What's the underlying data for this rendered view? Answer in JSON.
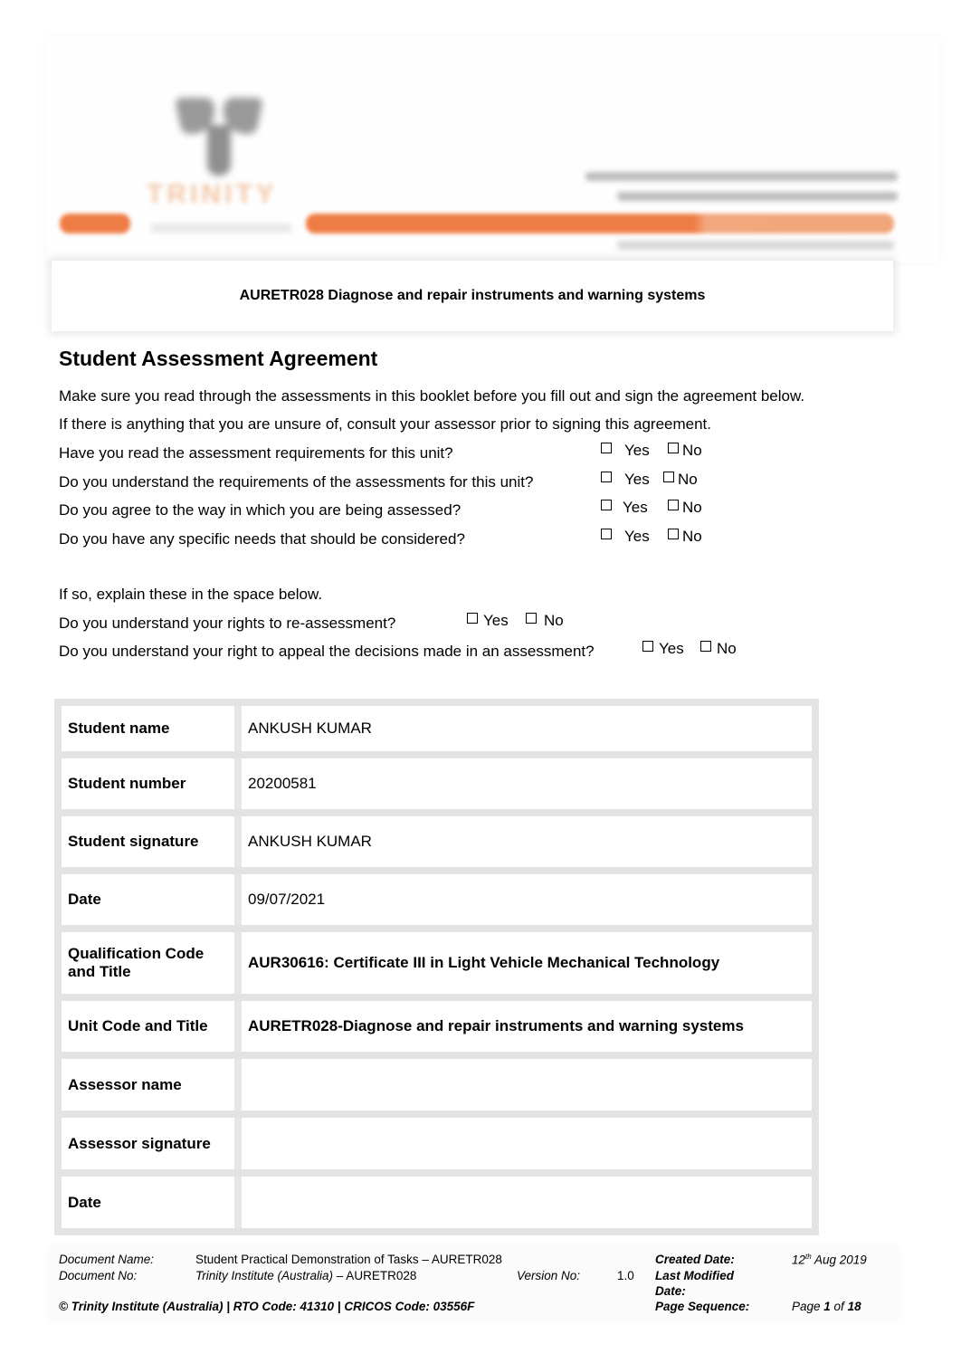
{
  "header": {
    "logo_name": "Trinity Institute logo",
    "brand_text": "TRINITY"
  },
  "title_box": {
    "title": "AURETR028 Diagnose and repair instruments and warning systems"
  },
  "agreement": {
    "heading": "Student Assessment Agreement",
    "intro_1": "Make sure you read through the assessments in this booklet before you fill out and sign the agreement below.",
    "intro_2": "If there is anything that you are unsure of, consult your assessor prior to signing this agreement.",
    "questions": [
      {
        "text": "Have you read the assessment requirements for this unit?",
        "yes": "Yes",
        "no": "No",
        "highlighted": "Yes"
      },
      {
        "text": "Do you understand the requirements of the assessments for this unit?",
        "yes": "Yes",
        "no": "No",
        "highlighted": "Yes"
      },
      {
        "text": "Do you agree to the way in which you are being assessed?",
        "yes": "Yes",
        "no": "No",
        "highlighted": "Yes"
      },
      {
        "text": "Do you have any specific needs that should be considered?",
        "yes": "Yes",
        "no": "No",
        "highlighted": "Yes"
      }
    ],
    "explain_note": "If so, explain these in the space below.",
    "rights_questions": [
      {
        "text": "Do you understand your rights to re-assessment?",
        "yes": "Yes",
        "no": "No",
        "highlighted": "Yes"
      },
      {
        "text": "Do you understand your right to appeal the decisions made in an assessment?",
        "yes": "Yes",
        "no": "No",
        "highlighted": "Yes"
      }
    ]
  },
  "details": {
    "rows": [
      {
        "label": "Student name",
        "value": "ANKUSH KUMAR"
      },
      {
        "label": "Student number",
        "value": "20200581"
      },
      {
        "label": "Student signature",
        "value": "ANKUSH KUMAR"
      },
      {
        "label": "Date",
        "value": "09/07/2021"
      },
      {
        "label": "Qualification Code and Title",
        "value": "AUR30616: Certificate III in Light Vehicle Mechanical Technology"
      },
      {
        "label": "Unit Code and Title",
        "value": "AURETR028-Diagnose and repair instruments and warning systems"
      },
      {
        "label": "Assessor name",
        "value": ""
      },
      {
        "label": "Assessor signature",
        "value": ""
      },
      {
        "label": "Date",
        "value": ""
      }
    ]
  },
  "footer": {
    "doc_name_label": "Document Name:",
    "doc_name_value": "Student Practical Demonstration of Tasks – AURETR028",
    "doc_no_label": "Document No:",
    "doc_no_value_italic": "Trinity Institute (Australia)",
    "doc_no_value_rest": " – AURETR028",
    "version_label": "Version No:",
    "version_value": "1.0",
    "created_label": "Created Date:",
    "created_day": "12",
    "created_suffix": "th",
    "created_rest": " Aug 2019",
    "modified_label_1": "Last Modified",
    "modified_label_2": "Date:",
    "page_seq_label": "Page Sequence:",
    "page_word": "Page ",
    "page_current": "1",
    "page_of": " of ",
    "page_total": "18",
    "copyright": "© Trinity Institute (Australia) | RTO Code: 41310 | CRICOS Code: 03556F"
  }
}
